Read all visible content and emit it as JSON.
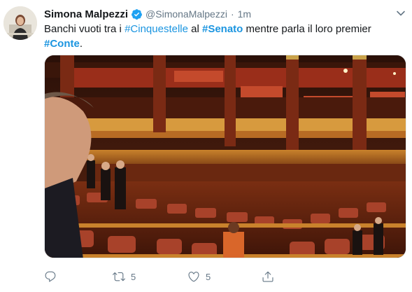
{
  "tweet": {
    "author_name": "Simona Malpezzi",
    "handle": "@SimonaMalpezzi",
    "separator": "·",
    "time": "1m",
    "text_parts": {
      "p1": "Banchi vuoti tra i ",
      "tag1": "#Cinquestelle",
      "p2": " al ",
      "tag2": "#Senato",
      "p3": " mentre parla il loro premier ",
      "tag3": "#Conte",
      "p4": "."
    },
    "actions": {
      "reply_count": "",
      "retweet_count": "5",
      "like_count": "5",
      "share_count": ""
    }
  },
  "colors": {
    "link": "#1b95e0",
    "muted": "#657786",
    "verified": "#1da1f2"
  },
  "icons": [
    "verified-badge-icon",
    "chevron-down-icon",
    "reply-icon",
    "retweet-icon",
    "like-icon",
    "share-icon"
  ]
}
